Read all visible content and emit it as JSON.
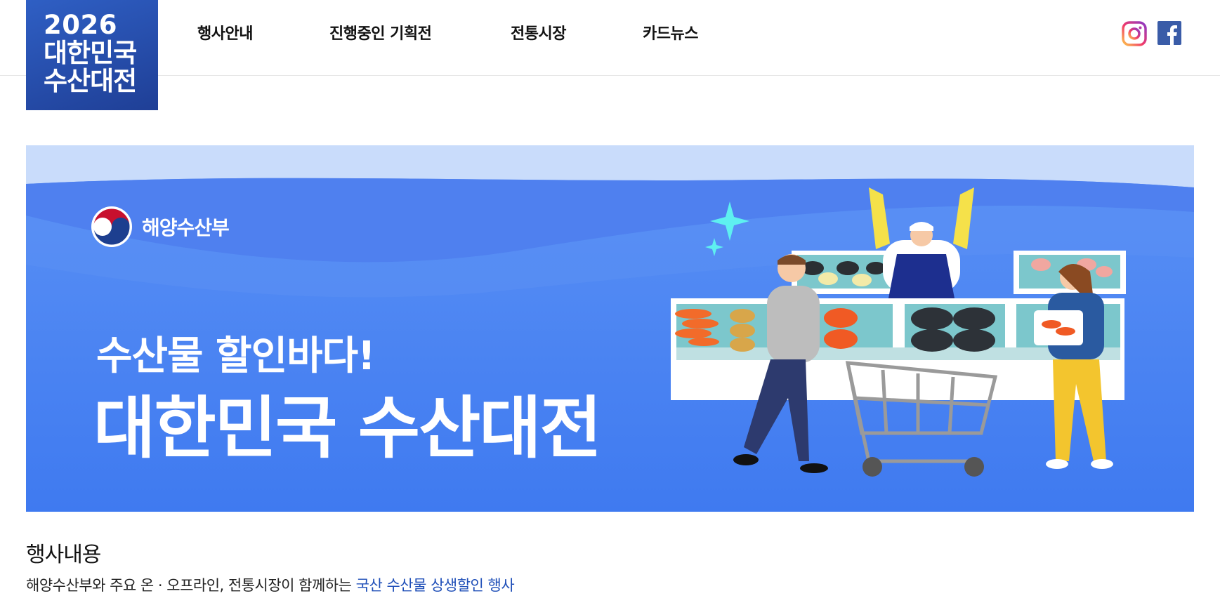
{
  "logo": {
    "line1": "2026",
    "line2": "대한민국",
    "line3": "수산대전"
  },
  "nav": {
    "items": [
      {
        "label": "행사안내"
      },
      {
        "label": "진행중인 기획전"
      },
      {
        "label": "전통시장"
      },
      {
        "label": "카드뉴스"
      }
    ]
  },
  "social": {
    "instagram_icon": "instagram-icon",
    "facebook_icon": "facebook-icon"
  },
  "banner": {
    "ministry": "해양수산부",
    "subtitle": "수산물 할인바다!",
    "title": "대한민국 수산대전"
  },
  "content": {
    "section_title": "행사내용",
    "desc_prefix": "해양수산부와 주요 온 · 오프라인, 전통시장이 함께하는 ",
    "desc_highlight": "국산 수산물 상생할인 행사"
  },
  "colors": {
    "logo_bg": "#2748a8",
    "banner_bg": "#4a83f2",
    "highlight": "#1f4fb8"
  }
}
